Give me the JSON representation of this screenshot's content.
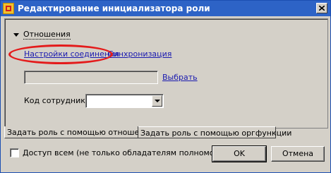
{
  "window": {
    "title": "Редактирование инициализатора роли",
    "app_icon": "app-icon",
    "close_icon": "close-icon"
  },
  "relations_group": {
    "label": "Отношения",
    "expanded": true
  },
  "links": {
    "connection_settings": "Настройки соединения",
    "sync": "Синхронизация",
    "select": "Выбрать"
  },
  "relation_field": {
    "value": ""
  },
  "employee_code": {
    "label": "Код сотрудника",
    "value": ""
  },
  "tabs": [
    {
      "label": "Задать роль с помощью отношения",
      "active": true
    },
    {
      "label": "Задать роль с помощью оргфункции",
      "active": false
    }
  ],
  "access_all": {
    "label": "Доступ всем (не только обладателям полномочий)",
    "checked": false
  },
  "buttons": {
    "ok": "OK",
    "cancel": "Отмена"
  },
  "colors": {
    "titlebar": "#2d63c6",
    "annotation": "#e41b1b",
    "link": "#1a1ab0",
    "dialog_bg": "#d4d0c8"
  }
}
